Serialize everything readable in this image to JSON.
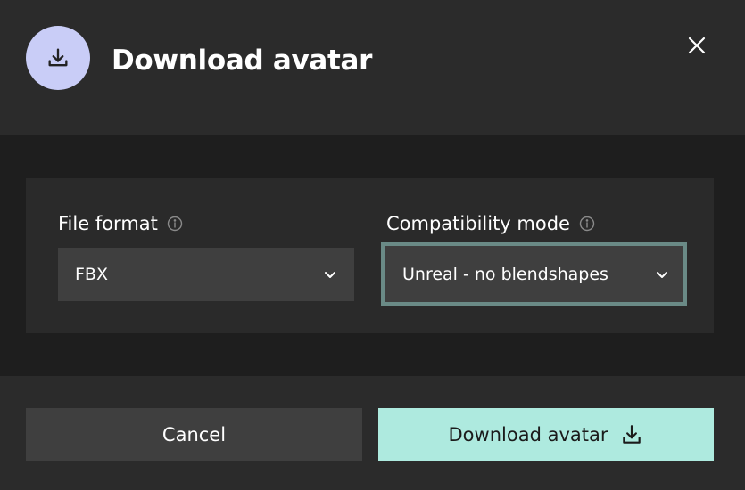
{
  "dialog": {
    "title": "Download avatar",
    "header_icon": "download-icon",
    "close_icon": "close-icon"
  },
  "fields": {
    "file_format": {
      "label": "File format",
      "value": "FBX",
      "info_icon": "info-icon",
      "chevron_icon": "chevron-down-icon"
    },
    "compatibility_mode": {
      "label": "Compatibility mode",
      "value": "Unreal - no blendshapes",
      "info_icon": "info-icon",
      "chevron_icon": "chevron-down-icon"
    }
  },
  "footer": {
    "cancel_label": "Cancel",
    "download_label": "Download avatar",
    "download_icon": "download-icon"
  },
  "colors": {
    "header_bg": "#2b2b2b",
    "body_bg": "#1e1e1e",
    "panel_bg": "#2a2a2a",
    "select_bg": "#3f3f3f",
    "focus_border": "#6a8a86",
    "icon_circle": "#c9cdf7",
    "primary_button": "#aeeadf",
    "secondary_button": "#3f3f3f"
  }
}
